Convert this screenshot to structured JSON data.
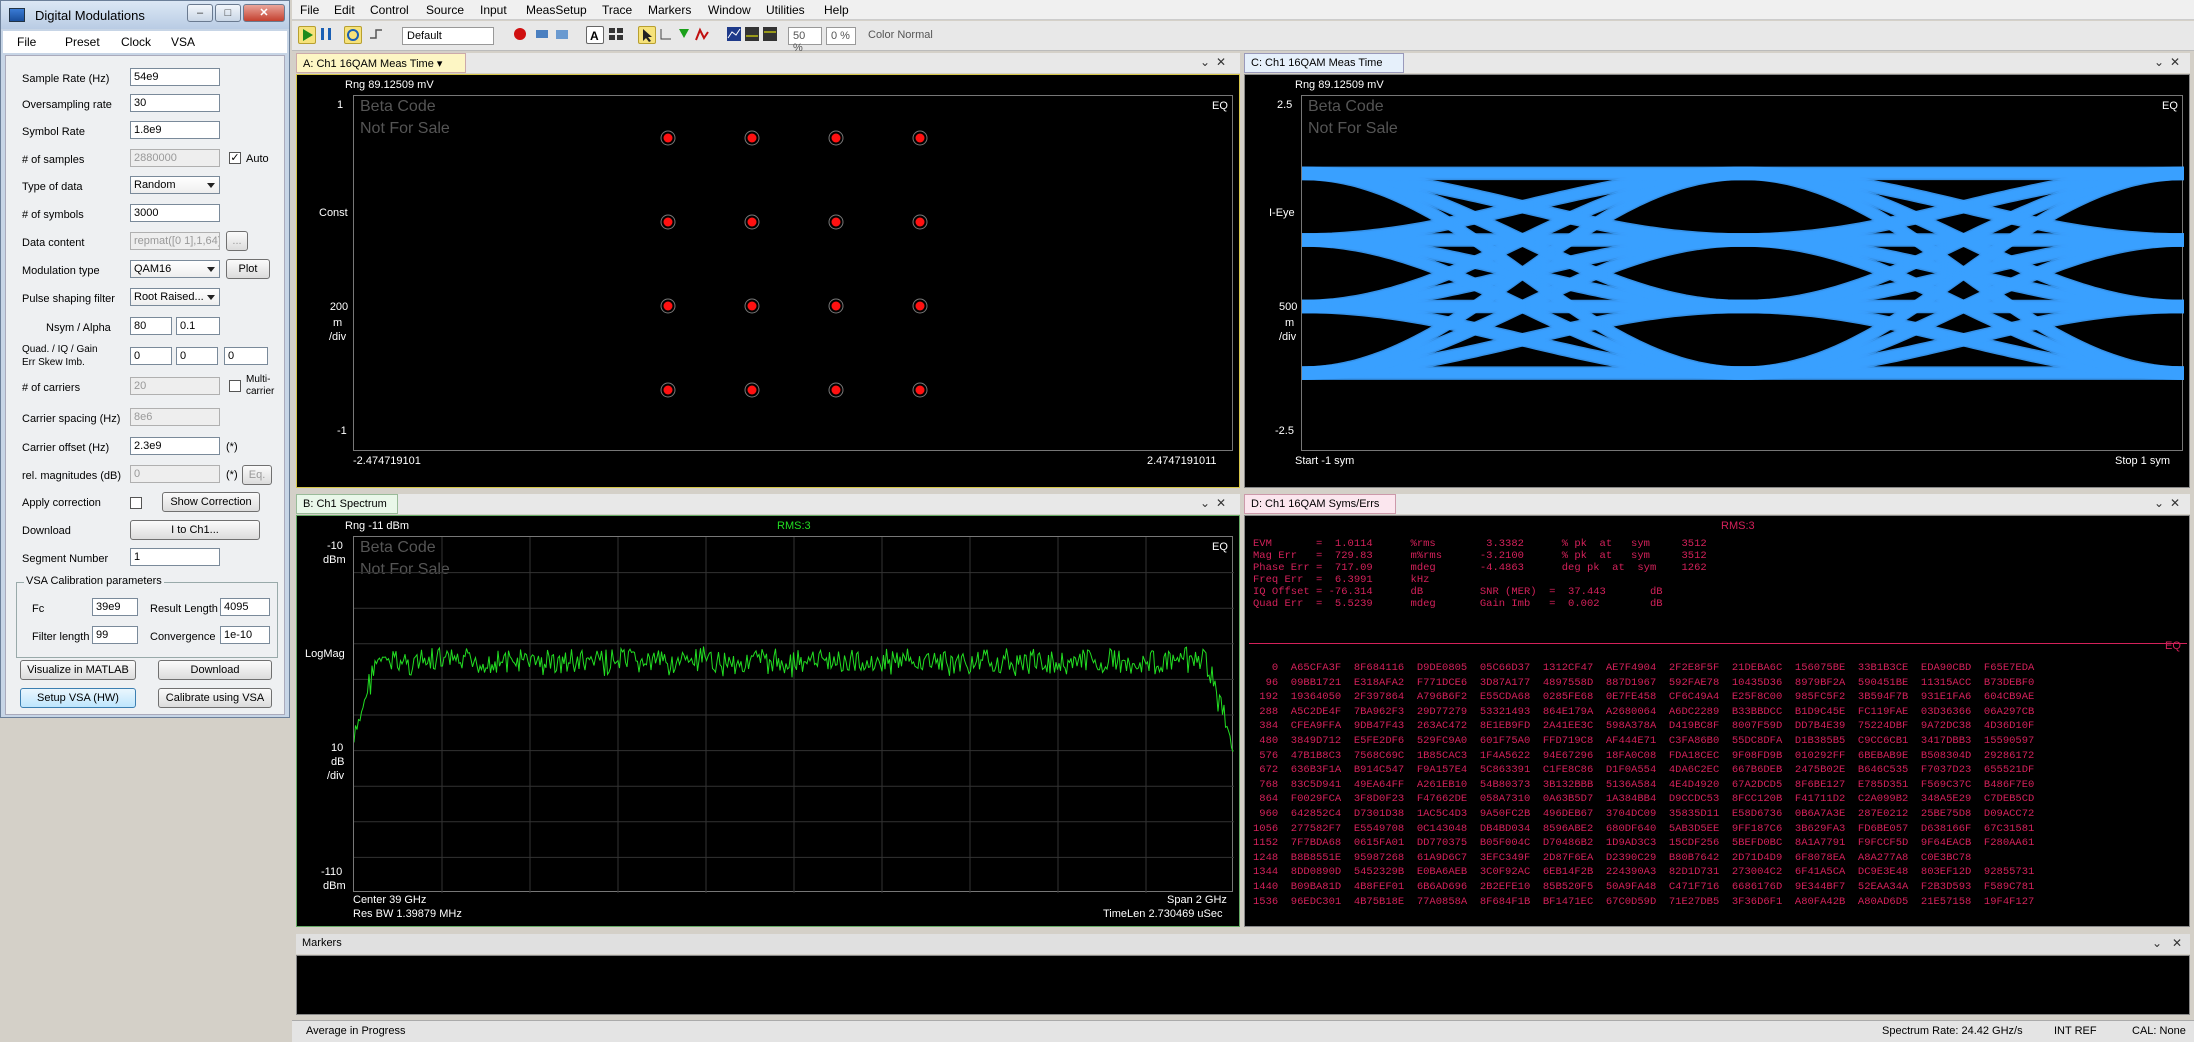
{
  "dialog": {
    "title": "Digital Modulations",
    "menu": [
      "File",
      "Preset",
      "Clock",
      "VSA"
    ],
    "fields": {
      "sample_rate_label": "Sample Rate (Hz)",
      "sample_rate": "54e9",
      "oversampling_label": "Oversampling rate",
      "oversampling": "30",
      "symbol_rate_label": "Symbol Rate",
      "symbol_rate": "1.8e9",
      "samples_label": "# of samples",
      "samples": "2880000",
      "auto_label": "Auto",
      "type_label": "Type of data",
      "type": "Random",
      "symbols_label": "# of symbols",
      "symbols": "3000",
      "data_content_label": "Data content",
      "data_content": "repmat([0 1],1,64)",
      "data_content_btn": "...",
      "mod_label": "Modulation type",
      "mod": "QAM16",
      "plot_btn": "Plot",
      "pulse_label": "Pulse shaping filter",
      "pulse": "Root Raised...",
      "nsym_label": "Nsym / Alpha",
      "nsym": "80",
      "alpha": "0.1",
      "quad_label1": "Quad. / IQ / Gain",
      "quad_label2": "Err    Skew   Imb.",
      "quad": "0",
      "iq": "0",
      "gain": "0",
      "carriers_label": "# of carriers",
      "carriers": "20",
      "multi_label": "Multi-carrier",
      "spacing_label": "Carrier spacing (Hz)",
      "spacing": "8e6",
      "offset_label": "Carrier offset (Hz)",
      "offset": "2.3e9",
      "offset_unit": "(*)",
      "relmag_label": "rel. magnitudes (dB)",
      "relmag": "0",
      "relmag_unit": "(*)",
      "eq_btn": "Eq.",
      "apply_label": "Apply correction",
      "show_corr_btn": "Show Correction",
      "download_label": "Download",
      "download_btn": "I to Ch1...",
      "segment_label": "Segment Number",
      "segment": "1",
      "vsa_group": "VSA Calibration parameters",
      "fc_label": "Fc",
      "fc": "39e9",
      "result_len_label": "Result Length",
      "result_len": "4095",
      "filter_len_label": "Filter length",
      "filter_len": "99",
      "conv_label": "Convergence",
      "conv": "1e-10",
      "vis_btn": "Visualize in MATLAB",
      "dl_btn": "Download",
      "setup_btn": "Setup VSA (HW)",
      "calib_btn": "Calibrate using VSA"
    }
  },
  "app": {
    "menu": [
      "File",
      "Edit",
      "Control",
      "Source",
      "Input",
      "MeasSetup",
      "Trace",
      "Markers",
      "Window",
      "Utilities",
      "Help"
    ],
    "toolbar": {
      "preset": "Default",
      "pct1": "50 %",
      "pct2": "0 %",
      "color": "Color Normal"
    },
    "panels": {
      "a": {
        "tab": "A: Ch1 16QAM Meas Time",
        "range": "Rng 89.12509 mV",
        "y_top": "1",
        "y_mid": "Const",
        "y_scale1": "200",
        "y_scale2": "m",
        "y_scale3": "/div",
        "y_bot": "-1",
        "x_left": "-2.474719101",
        "x_right": "2.4747191011",
        "eq": "EQ",
        "beta1": "Beta Code",
        "beta2": "Not For Sale"
      },
      "c": {
        "tab": "C: Ch1 16QAM Meas Time",
        "range": "Rng 89.12509 mV",
        "y_top": "2.5",
        "y_mid": "I-Eye",
        "y_scale1": "500",
        "y_scale2": "m",
        "y_scale3": "/div",
        "y_bot": "-2.5",
        "x_left": "Start -1  sym",
        "x_right": "Stop 1  sym",
        "eq": "EQ",
        "beta1": "Beta Code",
        "beta2": "Not For Sale"
      },
      "b": {
        "tab": "B: Ch1 Spectrum",
        "range": "Rng -11 dBm",
        "rms": "RMS:3",
        "y_top1": "-10",
        "y_top2": "dBm",
        "y_mid": "LogMag",
        "y_scale1": "10",
        "y_scale2": "dB",
        "y_scale3": "/div",
        "y_bot1": "-110",
        "y_bot2": "dBm",
        "center": "Center 39 GHz",
        "span": "Span 2 GHz",
        "resbw": "Res BW 1.39879 MHz",
        "timelen": "TimeLen 2.730469 uSec",
        "eq": "EQ",
        "beta1": "Beta Code",
        "beta2": "Not For Sale"
      },
      "d": {
        "tab": "D: Ch1 16QAM Syms/Errs",
        "rms": "RMS:3",
        "eq": "EQ",
        "stats": [
          "EVM       =  1.0114      %rms        3.3382      % pk  at   sym     3512",
          "Mag Err   =  729.83      m%rms      -3.2100      % pk  at   sym     3512",
          "Phase Err =  717.09      mdeg       -4.4863      deg pk  at  sym    1262",
          "Freq Err  =  6.3991      kHz",
          "IQ Offset = -76.314      dB         SNR (MER)  =  37.443       dB",
          "Quad Err  =  5.5239      mdeg       Gain Imb   =  0.002        dB"
        ],
        "rows": [
          "   0  A65CFA3F  8F684116  D9DE0805  05C66D37  1312CF47  AE7F4904  2F2E8F5F  21DEBA6C  156075BE  33B1B3CE  EDA90CBD  F65E7EDA",
          "  96  09BB1721  E318AFA2  F771DCE6  3D87A177  4897558D  887D1967  592FAE78  10435D36  8979BF2A  590451BE  11315ACC  B73DEBF0",
          " 192  19364050  2F397864  A796B6F2  E55CDA68  0285FE68  0E7FE458  CF6C49A4  E25F8C00  985FC5F2  3B594F7B  931E1FA6  604CB9AE",
          " 288  A5C2DE4F  7BA962F3  29D77279  53321493  864E179A  A2680064  A6DC2289  B33BBDCC  B1D9C45E  FC119FAE  03D36366  06A297CB",
          " 384  CFEA9FFA  9DB47F43  263AC472  8E1EB9FD  2A41EE3C  598A378A  D419BC8F  8007F59D  DD7B4E39  75224DBF  9A72DC38  4D36D10F",
          " 480  3849D712  E5FE2DF6  529FC9A0  601F75A0  FFD719C8  AF444E71  C3FA86B0  55DC8DFA  D1B385B5  C9CC6CB1  3417DBB3  15590597",
          " 576  47B1B8C3  7568C69C  1B85CAC3  1F4A5622  94E67296  18FA0C08  FDA18CEC  9F08FD9B  010292FF  6BEBAB9E  B508304D  29286172",
          " 672  636B3F1A  B914C547  F9A157E4  5C863391  C1FE8C86  D1F0A554  4DA6C2EC  667B6DEB  2475B02E  B646C535  F7037D23  655521DF",
          " 768  83C5D941  49EA64FF  A261EB10  54B80373  3B132BBB  5136A584  4E4D4920  67A2DCD5  8F6BE127  E785D351  F569C37C  B486F7E0",
          " 864  F0029FCA  3F8D0F23  F47662DE  058A7310  0A63B5D7  1A384BB4  D9CCDC53  8FCC120B  F41711D2  C2A099B2  348A5E29  C7DEB5CD",
          " 960  642852C4  D7301D38  1AC5C4D3  9A50FC2B  496DEB67  3704DC09  35835D11  E58D6736  0B6A7A3E  287E0212  25BE75D8  D09ACC72",
          "1056  277582F7  E5549708  0C143048  DB4BD034  8596ABE2  680DF640  5AB3D5EE  9FF187C6  3B629FA3  FD6BE057  D638166F  67C31581",
          "1152  7F7BDA68  0615FA01  DD770375  B05F004C  D70486B2  1D9AD3C3  15CDF256  5BEFD0BC  8A1A7791  F9FCCF5D  9F64EACB  F280AA61",
          "1248  B8B8551E  95987268  61A9D6C7  3EFC349F  2D87F6EA  D2390C29  B80B7642  2D71D4D9  6F8078EA  A8A277A8  C0E3BC78",
          "1344  8DD0890D  5452329B  E0BA6AEB  3C0F92AC  6EB14F2B  224390A3  82D1D731  273004C2  6F41A5CA  DC9E3E48  803EF12D  92855731",
          "1440  B09BA81D  4B8FEF01  6B6AD696  2B2EFE10  85B520F5  50A9FA48  C471F716  6686176D  9E344BF7  52EAA34A  F2B3D593  F589C781",
          "1536  96EDC301  4B75B18E  77A0858A  8F684F1B  BF1471EC  67C0D59D  71E27DB5  3F36D6F1  A80FA42B  A80AD6D5  21E57158  19F4F127"
        ]
      }
    },
    "markers_panel": "Markers",
    "status": {
      "left": "Average in Progress",
      "spectrum": "Spectrum Rate: 24.42 GHz/s",
      "ref": "INT REF",
      "cal": "CAL: None"
    },
    "colors": {
      "accent_tab_a": "#fdf6c4",
      "trace_blue": "#3aa0ff",
      "trace_green": "#22dd22",
      "trace_red": "#ff1111",
      "err_text": "#d3215a"
    }
  }
}
